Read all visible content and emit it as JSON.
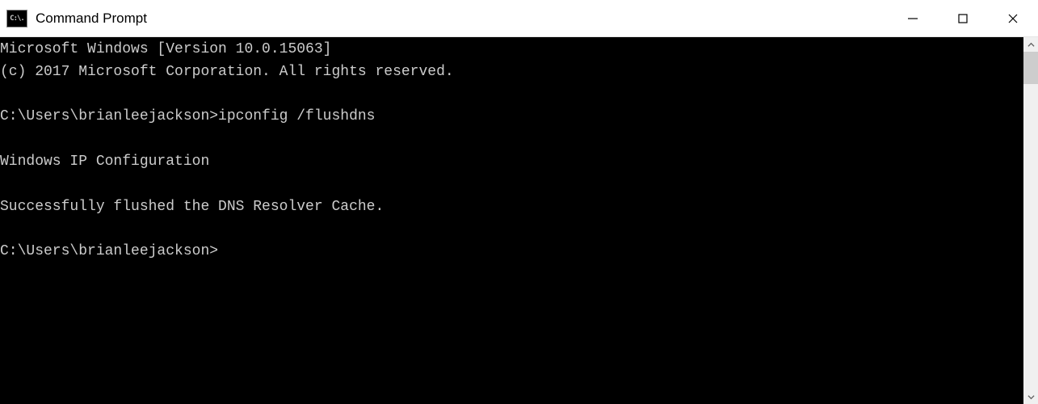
{
  "window": {
    "title": "Command Prompt",
    "icon_text": "C:\\."
  },
  "terminal": {
    "lines": [
      "Microsoft Windows [Version 10.0.15063]",
      "(c) 2017 Microsoft Corporation. All rights reserved.",
      "",
      "C:\\Users\\brianleejackson>ipconfig /flushdns",
      "",
      "Windows IP Configuration",
      "",
      "Successfully flushed the DNS Resolver Cache.",
      "",
      "C:\\Users\\brianleejackson>"
    ]
  }
}
